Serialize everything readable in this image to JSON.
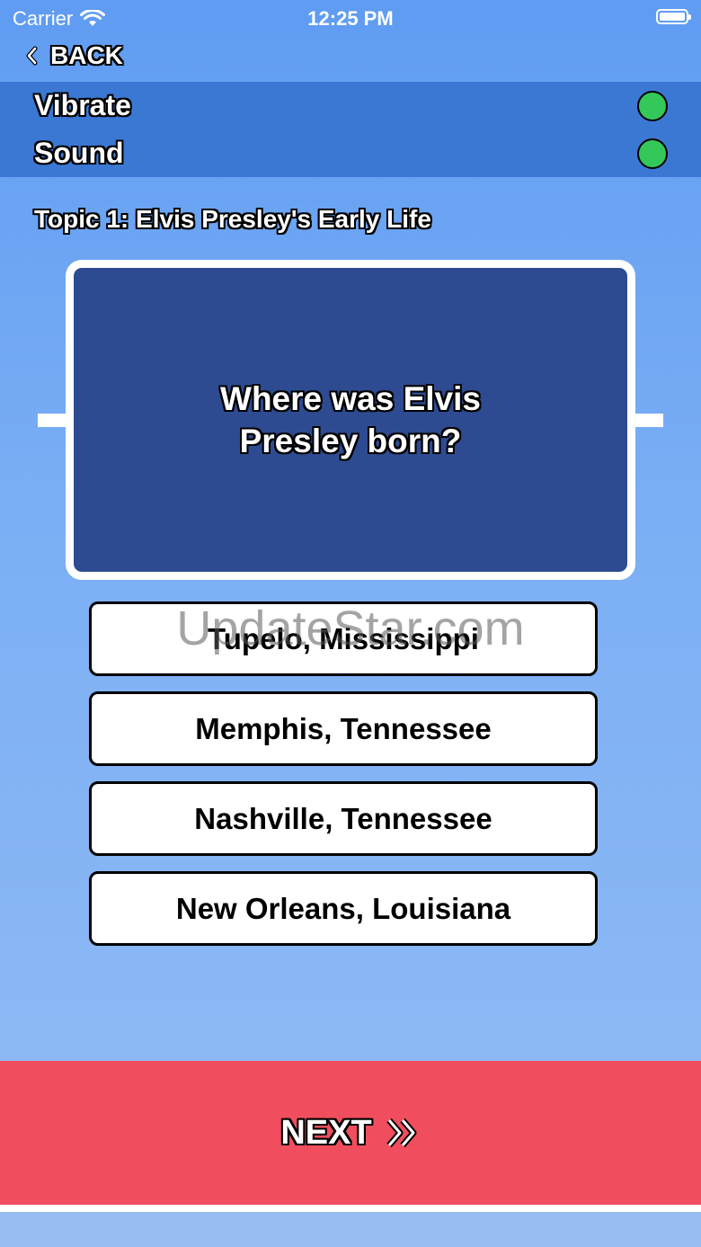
{
  "status_bar": {
    "carrier": "Carrier",
    "time": "12:25 PM"
  },
  "nav": {
    "back_label": "BACK"
  },
  "settings": {
    "vibrate_label": "Vibrate",
    "vibrate_on": true,
    "sound_label": "Sound",
    "sound_on": true,
    "toggle_color": "#34c759"
  },
  "quiz": {
    "topic": "Topic 1: Elvis Presley's Early Life",
    "question": "Where was Elvis Presley born?",
    "answers": [
      "Tupelo, Mississippi",
      "Memphis, Tennessee",
      "Nashville, Tennessee",
      "New Orleans, Louisiana"
    ]
  },
  "watermark": "UpdateStar.com",
  "footer": {
    "next_label": "NEXT",
    "next_color": "#f04e5e"
  }
}
